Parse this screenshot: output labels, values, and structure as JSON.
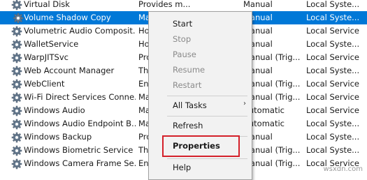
{
  "services": [
    {
      "name": "Virtual Disk",
      "description": "Provides m...",
      "startup": "Manual",
      "logon": "Local Syste...",
      "selected": false
    },
    {
      "name": "Volume Shadow Copy",
      "description": "Ma",
      "startup": "Manual",
      "logon": "Local Syste...",
      "selected": true
    },
    {
      "name": "Volumetric Audio Composit...",
      "description": "Ho",
      "startup": "Manual",
      "logon": "Local Service",
      "selected": false
    },
    {
      "name": "WalletService",
      "description": "Ho",
      "startup": "Manual",
      "logon": "Local Syste...",
      "selected": false
    },
    {
      "name": "WarpJITSvc",
      "description": "Pro",
      "startup": "Manual (Trig...",
      "logon": "Local Service",
      "selected": false
    },
    {
      "name": "Web Account Manager",
      "description": "Th",
      "startup": "Manual",
      "logon": "Local Syste...",
      "selected": false
    },
    {
      "name": "WebClient",
      "description": "En",
      "startup": "Manual (Trig...",
      "logon": "Local Service",
      "selected": false
    },
    {
      "name": "Wi-Fi Direct Services Conne...",
      "description": "Ma",
      "startup": "Manual (Trig...",
      "logon": "Local Service",
      "selected": false
    },
    {
      "name": "Windows Audio",
      "description": "Ma",
      "startup": "Automatic",
      "logon": "Local Service",
      "selected": false
    },
    {
      "name": "Windows Audio Endpoint B...",
      "description": "Ma",
      "startup": "Automatic",
      "logon": "Local Syste...",
      "selected": false
    },
    {
      "name": "Windows Backup",
      "description": "Pro",
      "startup": "Manual",
      "logon": "Local Syste...",
      "selected": false
    },
    {
      "name": "Windows Biometric Service",
      "description": "Th",
      "startup": "Manual (Trig...",
      "logon": "Local Syste...",
      "selected": false
    },
    {
      "name": "Windows Camera Frame Se...",
      "description": "En",
      "startup": "Manual (Trig...",
      "logon": "Local Service",
      "selected": false
    }
  ],
  "context_menu": {
    "start": "Start",
    "stop": "Stop",
    "pause": "Pause",
    "resume": "Resume",
    "restart": "Restart",
    "all_tasks": "All Tasks",
    "all_tasks_arrow": "›",
    "refresh": "Refresh",
    "properties": "Properties",
    "help": "Help"
  },
  "watermark": "wsxdn.com",
  "colors": {
    "selection": "#0078d7",
    "highlight_box": "#d4202a"
  }
}
